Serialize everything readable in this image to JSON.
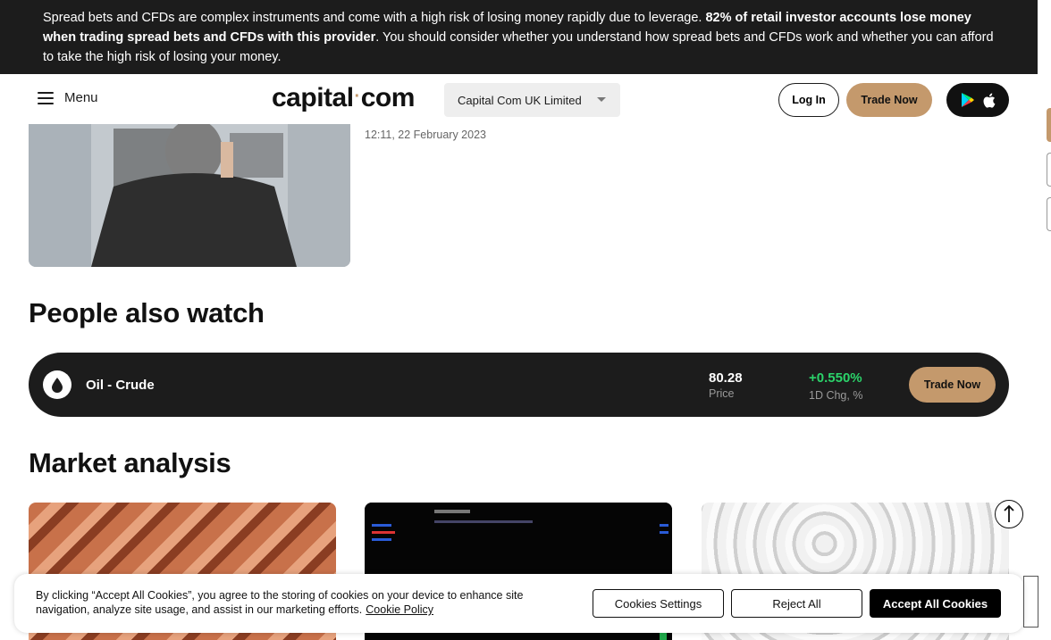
{
  "risk_warning": {
    "text_start": "Spread bets and CFDs are complex instruments and come with a high risk of losing money rapidly due to leverage. ",
    "text_bold": "82% of retail investor accounts lose money when trading spread bets and CFDs with this provider",
    "text_end": ". You should consider whether you understand how spread bets and CFDs work and whether you can afford to take the high risk of losing your money."
  },
  "header": {
    "menu_label": "Menu",
    "logo_left": "capital",
    "logo_dot": "·",
    "logo_right": "com",
    "entity_selected": "Capital Com UK Limited",
    "login_label": "Log In",
    "trade_label": "Trade Now"
  },
  "article": {
    "date": "12:11, 22 February 2023"
  },
  "people_also_watch": {
    "title": "People also watch",
    "instrument": {
      "name": "Oil - Crude",
      "icon": "oil-drop-icon",
      "price": "80.28",
      "price_label": "Price",
      "change": "+0.550%",
      "change_label": "1D Chg, %",
      "trade_label": "Trade Now"
    }
  },
  "market_analysis": {
    "title": "Market analysis"
  },
  "cookie_bar": {
    "text": "By clicking “Accept All Cookies”, you agree to the storing of cookies on your device to enhance site navigation, analyze site usage, and assist in our marketing efforts.",
    "policy_link": "Cookie Policy",
    "settings_label": "Cookies Settings",
    "reject_label": "Reject All",
    "accept_label": "Accept All Cookies"
  },
  "colors": {
    "accent": "#c4996c",
    "dark": "#1c1c1c",
    "positive": "#2bd36a"
  }
}
